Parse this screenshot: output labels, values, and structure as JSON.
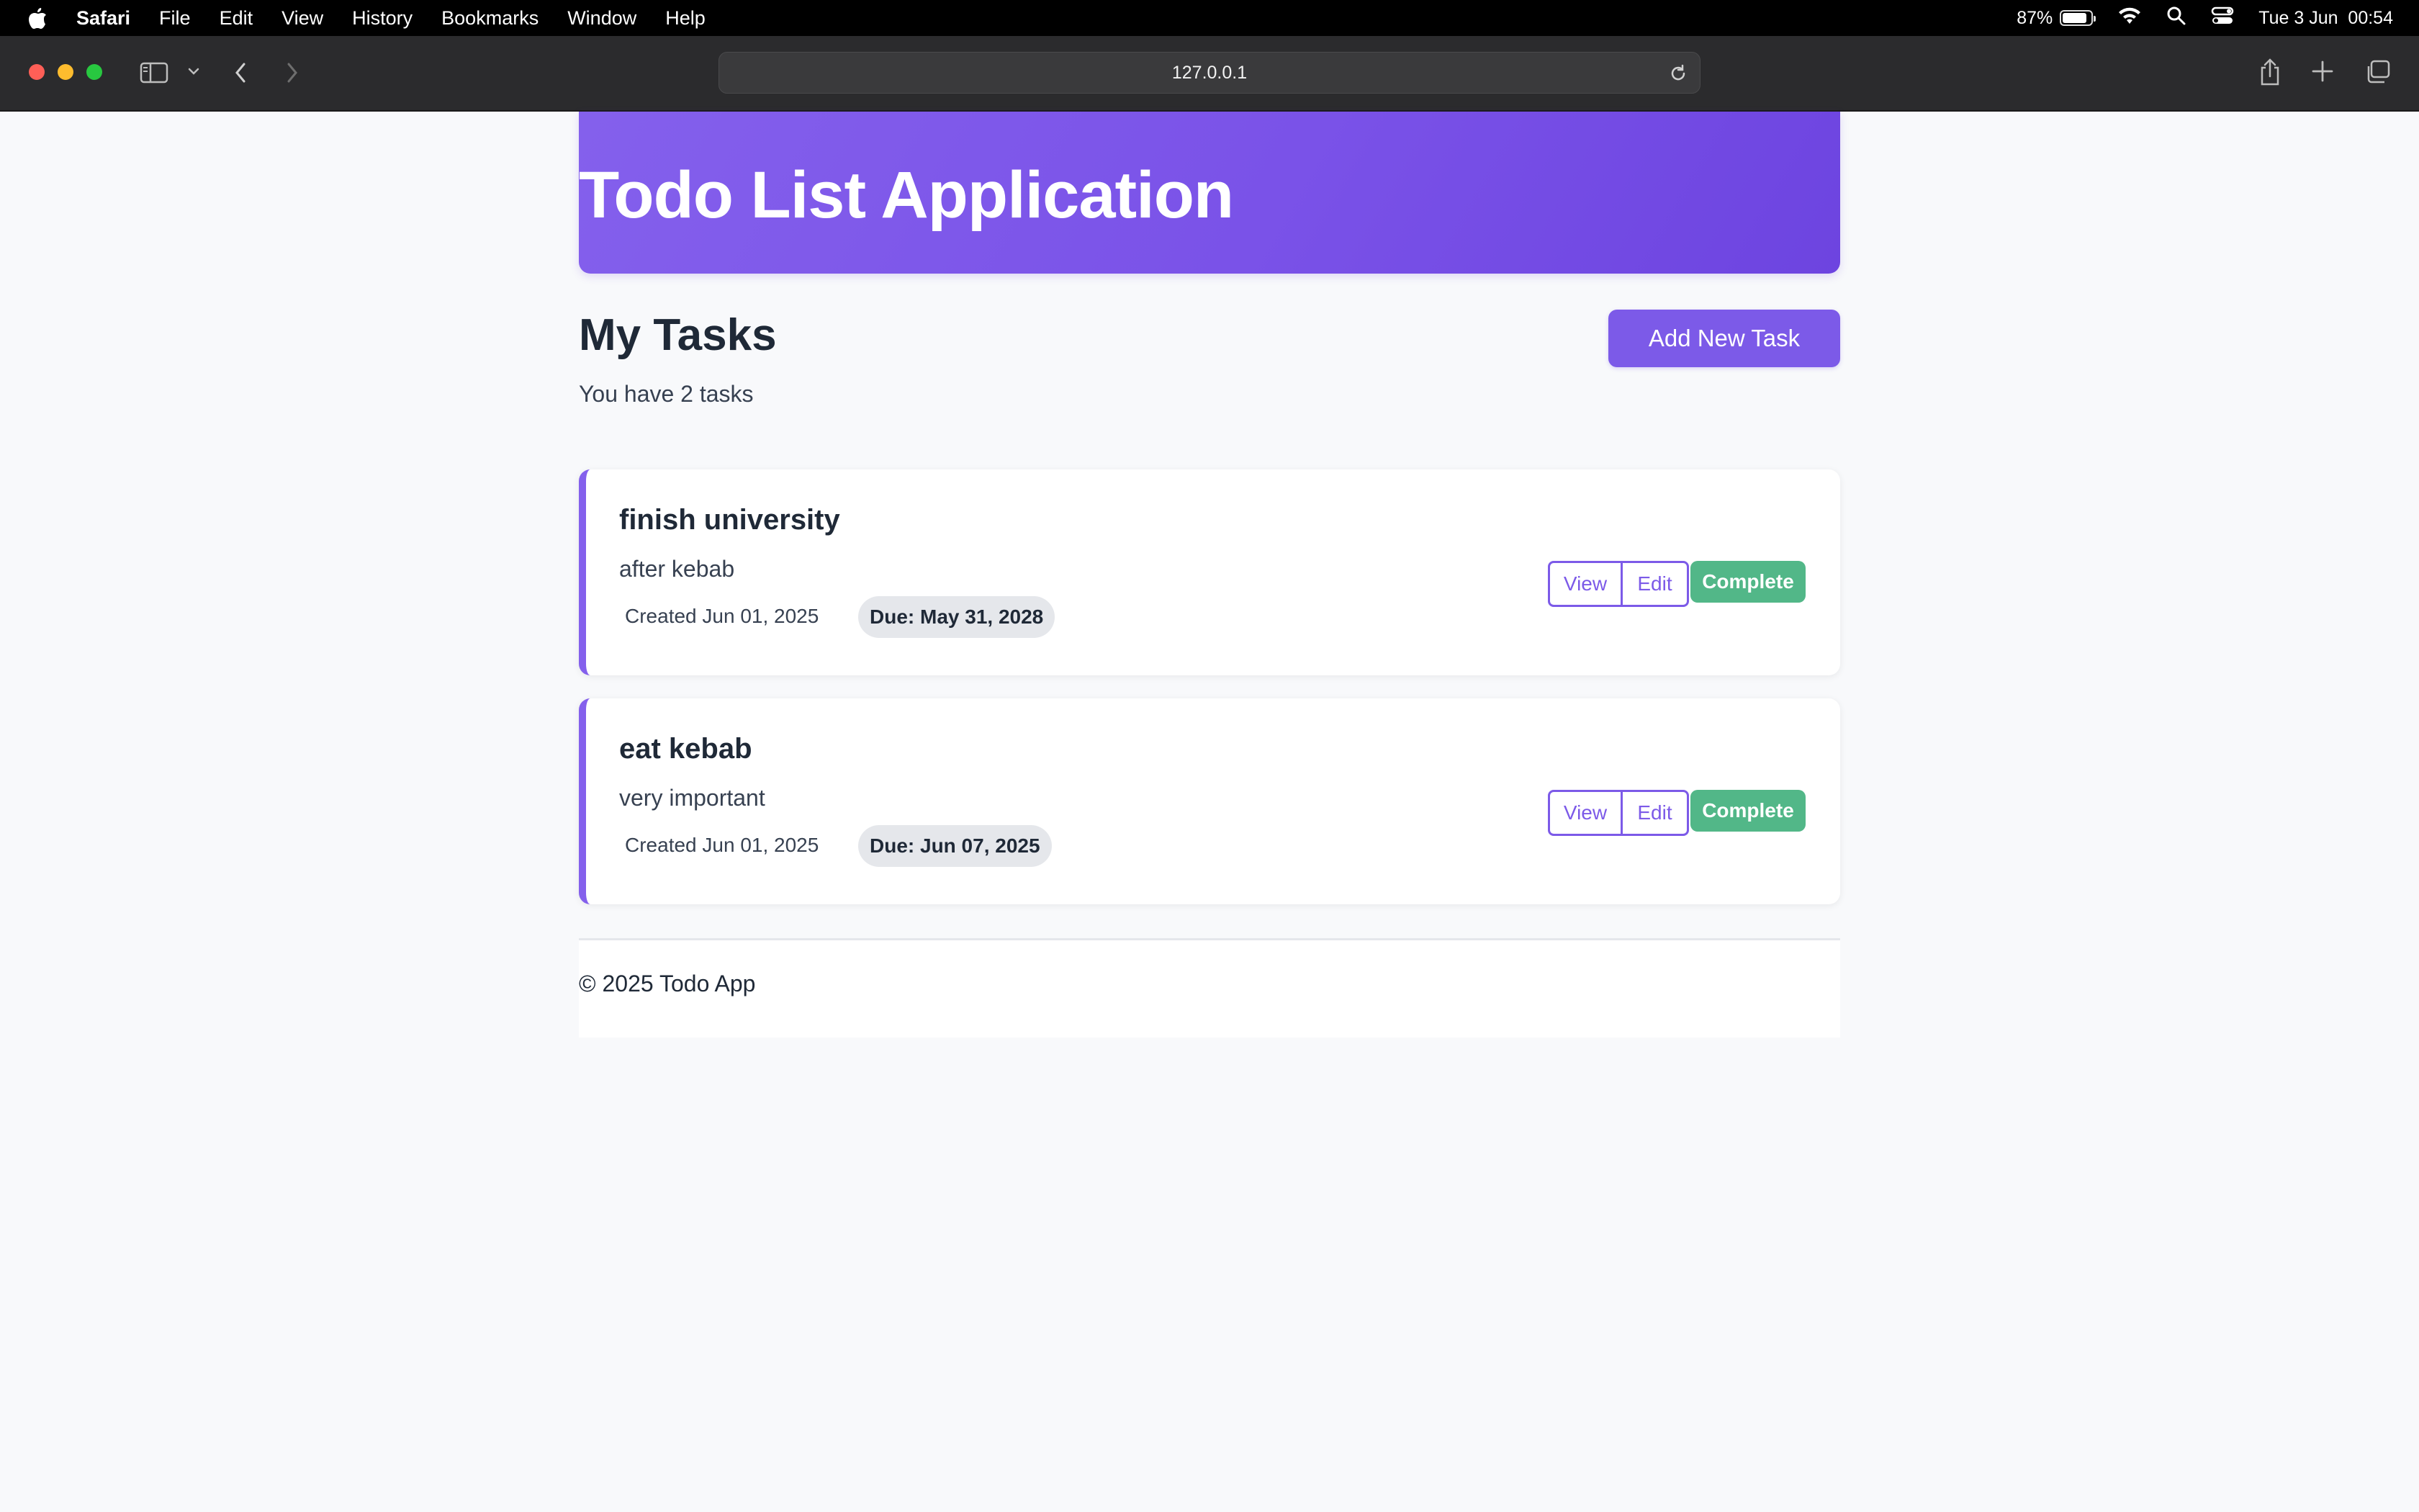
{
  "menubar": {
    "app_name": "Safari",
    "items": [
      "File",
      "Edit",
      "View",
      "History",
      "Bookmarks",
      "Window",
      "Help"
    ],
    "battery_percent": "87%",
    "battery_level": 0.87,
    "datetime": "Tue 3 Jun  00:54"
  },
  "browser": {
    "url": "127.0.0.1"
  },
  "header": {
    "title": "Todo List Application"
  },
  "main": {
    "section_title": "My Tasks",
    "count_text": "You have 2 tasks",
    "add_button_label": "Add New Task",
    "tasks": [
      {
        "title": "finish university",
        "description": "after kebab",
        "created": "Created Jun 01, 2025",
        "due": "Due: May 31, 2028",
        "view_label": "View",
        "edit_label": "Edit",
        "complete_label": "Complete"
      },
      {
        "title": "eat kebab",
        "description": "very important",
        "created": "Created Jun 01, 2025",
        "due": "Due: Jun 07, 2025",
        "view_label": "View",
        "edit_label": "Edit",
        "complete_label": "Complete"
      }
    ]
  },
  "footer": {
    "text": "© 2025 Todo App"
  },
  "colors": {
    "accent": "#7c5ae8",
    "header_gradient_start": "#8460ec",
    "header_gradient_end": "#6d44e0",
    "complete": "#52b788",
    "due_badge_bg": "#e5e7eb"
  },
  "icons": {
    "menubar": [
      "apple-icon",
      "battery-icon",
      "wifi-icon",
      "spotlight-search-icon",
      "control-center-icon"
    ],
    "toolbar": [
      "sidebar-icon",
      "chevron-down-icon",
      "back-icon",
      "forward-icon",
      "reload-icon",
      "share-icon",
      "new-tab-icon",
      "tab-overview-icon"
    ]
  }
}
